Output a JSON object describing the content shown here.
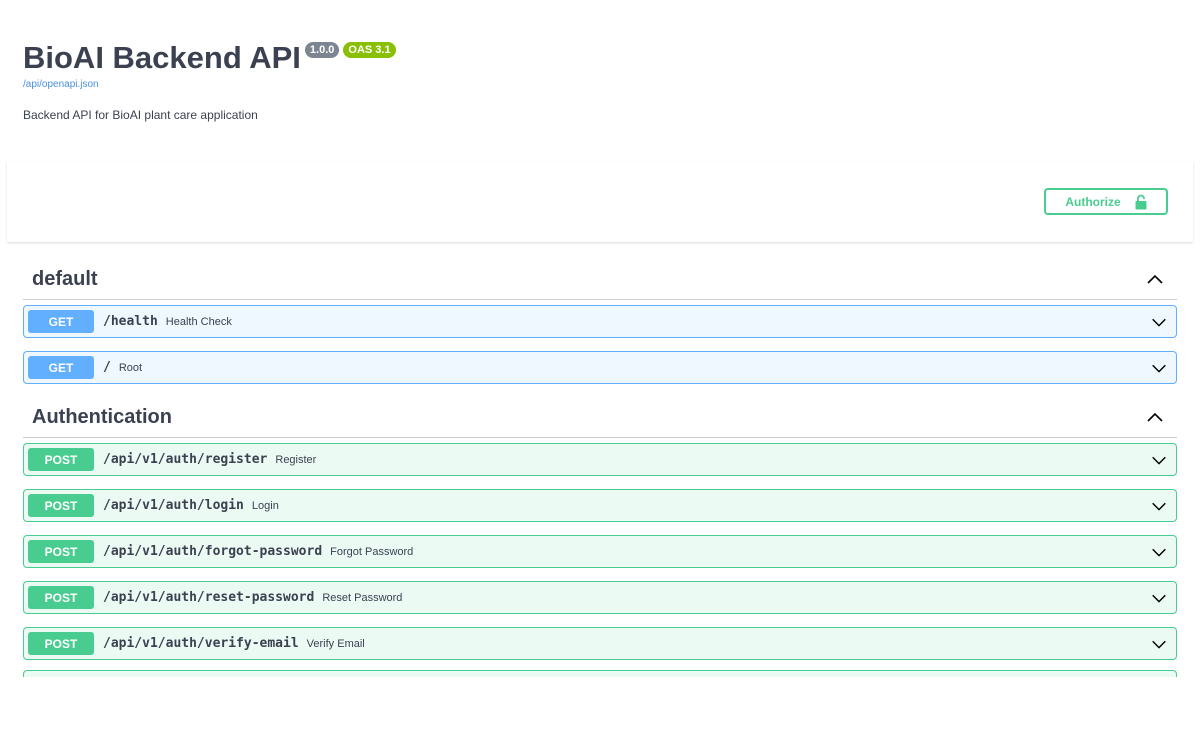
{
  "info": {
    "title": "BioAI Backend API",
    "version_badge": "1.0.0",
    "oas_badge": "OAS 3.1",
    "spec_link": "/api/openapi.json",
    "description": "Backend API for BioAI plant care application"
  },
  "authorize": {
    "label": "Authorize",
    "icon": "lock-open-icon",
    "color": "#49cc90"
  },
  "colors": {
    "get": "#61affe",
    "post": "#49cc90",
    "text": "#3b4151"
  },
  "tags": [
    {
      "name": "default",
      "operations": [
        {
          "method": "GET",
          "path": "/health",
          "summary": "Health Check"
        },
        {
          "method": "GET",
          "path": "/",
          "summary": "Root"
        }
      ]
    },
    {
      "name": "Authentication",
      "operations": [
        {
          "method": "POST",
          "path": "/api/v1/auth/register",
          "summary": "Register"
        },
        {
          "method": "POST",
          "path": "/api/v1/auth/login",
          "summary": "Login"
        },
        {
          "method": "POST",
          "path": "/api/v1/auth/forgot-password",
          "summary": "Forgot Password"
        },
        {
          "method": "POST",
          "path": "/api/v1/auth/reset-password",
          "summary": "Reset Password"
        },
        {
          "method": "POST",
          "path": "/api/v1/auth/verify-email",
          "summary": "Verify Email"
        }
      ]
    }
  ]
}
